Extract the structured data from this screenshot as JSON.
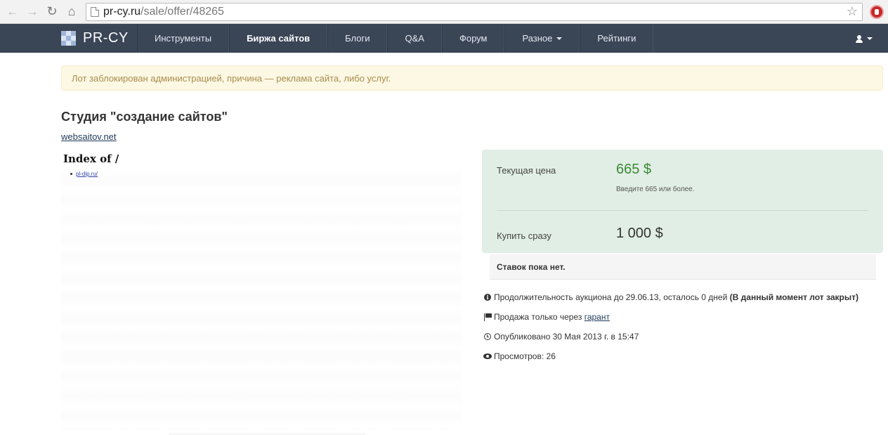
{
  "browser": {
    "url_host": "pr-cy.ru",
    "url_path": "/sale/offer/48265"
  },
  "navbar": {
    "brand": "PR-CY",
    "items": [
      {
        "label": "Инструменты"
      },
      {
        "label": "Биржа сайтов",
        "active": true
      },
      {
        "label": "Блоги"
      },
      {
        "label": "Q&A"
      },
      {
        "label": "Форум"
      },
      {
        "label": "Разное"
      },
      {
        "label": "Рейтинги"
      }
    ]
  },
  "alert": {
    "text": "Лот заблокирован администрацией, причина — реклама сайта, либо услуг."
  },
  "offer": {
    "title": "Студия \"создание сайтов\"",
    "site": "websaitov.net"
  },
  "preview": {
    "title": "Index of /",
    "link": "pl-dip.ru/"
  },
  "pricing": {
    "current_label": "Текущая цена",
    "current_value": "665 $",
    "hint": "Введите 665 или более.",
    "buy_label": "Купить сразу",
    "buy_value": "1 000 $"
  },
  "bids": {
    "text": "Ставок пока нет."
  },
  "info": {
    "duration": "Продолжительность аукциона до 29.06.13, осталось 0 дней",
    "closed": "(В данный момент лот закрыт)",
    "sale_text": "Продажа только через",
    "garant": "гарант",
    "published": "Опубликовано 30 Мая 2013 г. в 15:47",
    "views": "Просмотров: 26"
  }
}
